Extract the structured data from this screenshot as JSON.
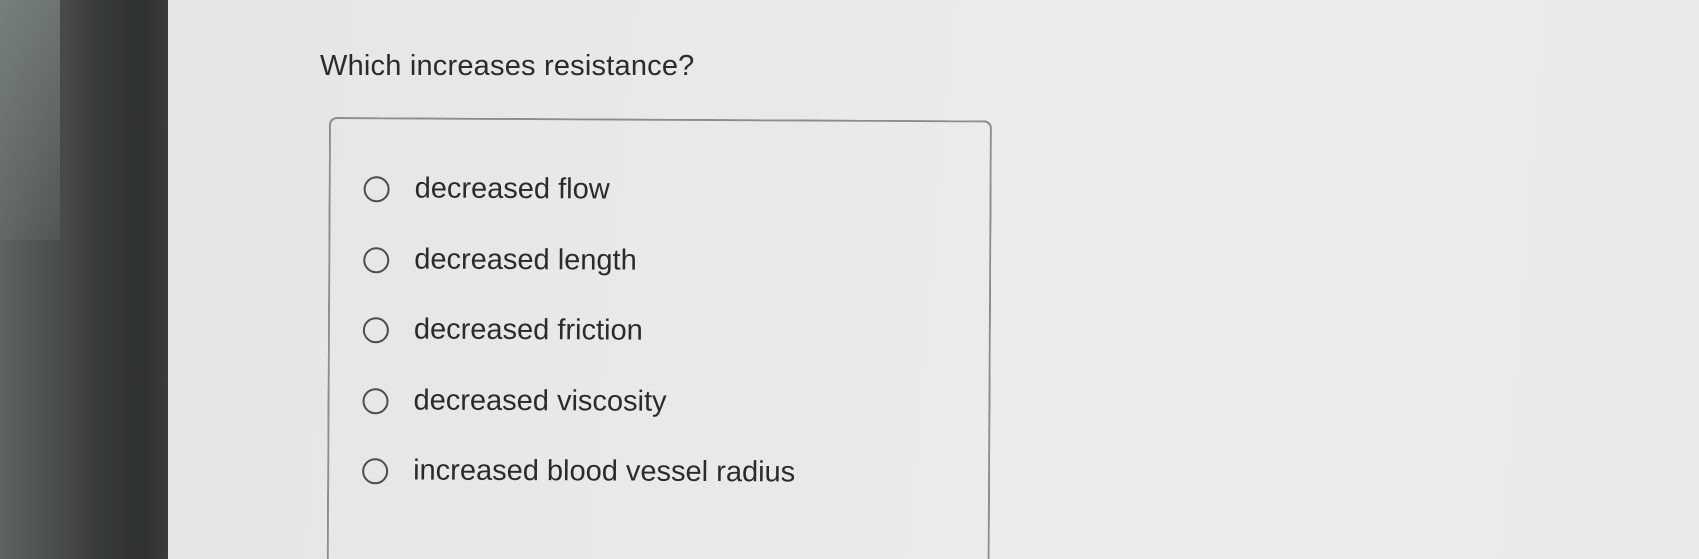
{
  "question": {
    "text": "Which increases resistance?"
  },
  "options": [
    {
      "label": "decreased flow",
      "selected": false
    },
    {
      "label": "decreased length",
      "selected": false
    },
    {
      "label": "decreased friction",
      "selected": false
    },
    {
      "label": "decreased viscosity",
      "selected": false
    },
    {
      "label": "increased blood vessel radius",
      "selected": false
    }
  ]
}
